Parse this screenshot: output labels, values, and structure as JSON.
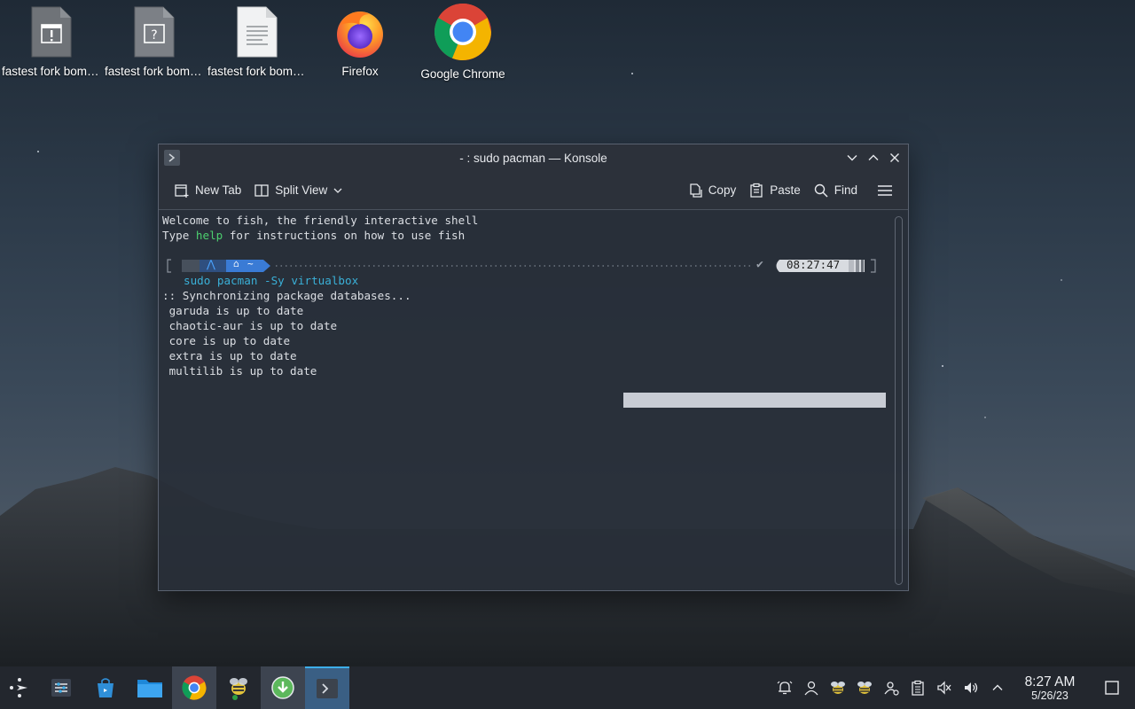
{
  "desktop": {
    "icons": [
      {
        "label": "fastest fork bomb possible...",
        "icon": "warning-document-icon"
      },
      {
        "label": "fastest fork bomb possible...",
        "icon": "unknown-document-icon"
      },
      {
        "label": "fastest fork bomb possible...",
        "icon": "text-document-icon"
      },
      {
        "label": "Firefox",
        "icon": "firefox-icon"
      },
      {
        "label": "Google Chrome",
        "icon": "chrome-icon"
      }
    ]
  },
  "window": {
    "title": "- : sudo pacman — Konsole",
    "toolbar": {
      "new_tab": "New Tab",
      "split_view": "Split View",
      "copy": "Copy",
      "paste": "Paste",
      "find": "Find"
    },
    "terminal": {
      "welcome": "Welcome to fish, the friendly interactive shell",
      "help_prefix": "Type ",
      "help_word": "help",
      "help_suffix": " for instructions on how to use fish",
      "prompt_home": "~",
      "prompt_time": "08:27:47",
      "cmd_sudo": "sudo ",
      "cmd_pacman": "pacman",
      "cmd_args": " -Sy virtualbox",
      "output": [
        ":: Synchronizing package databases...",
        " garuda is up to date",
        " chaotic-aur is up to date",
        " core is up to date",
        " extra is up to date",
        " multilib is up to date"
      ]
    }
  },
  "taskbar": {
    "apps": [
      "app-launcher",
      "settings",
      "software-store",
      "file-manager",
      "google-chrome",
      "garuda-assistant",
      "downloader",
      "konsole"
    ],
    "clock_time": "8:27 AM",
    "clock_date": "5/26/23"
  },
  "colors": {
    "accent": "#3daee9",
    "prompt_blue": "#3a7bd5",
    "shell_green": "#4ccf6f",
    "shell_cyan": "#3ab0d8"
  }
}
